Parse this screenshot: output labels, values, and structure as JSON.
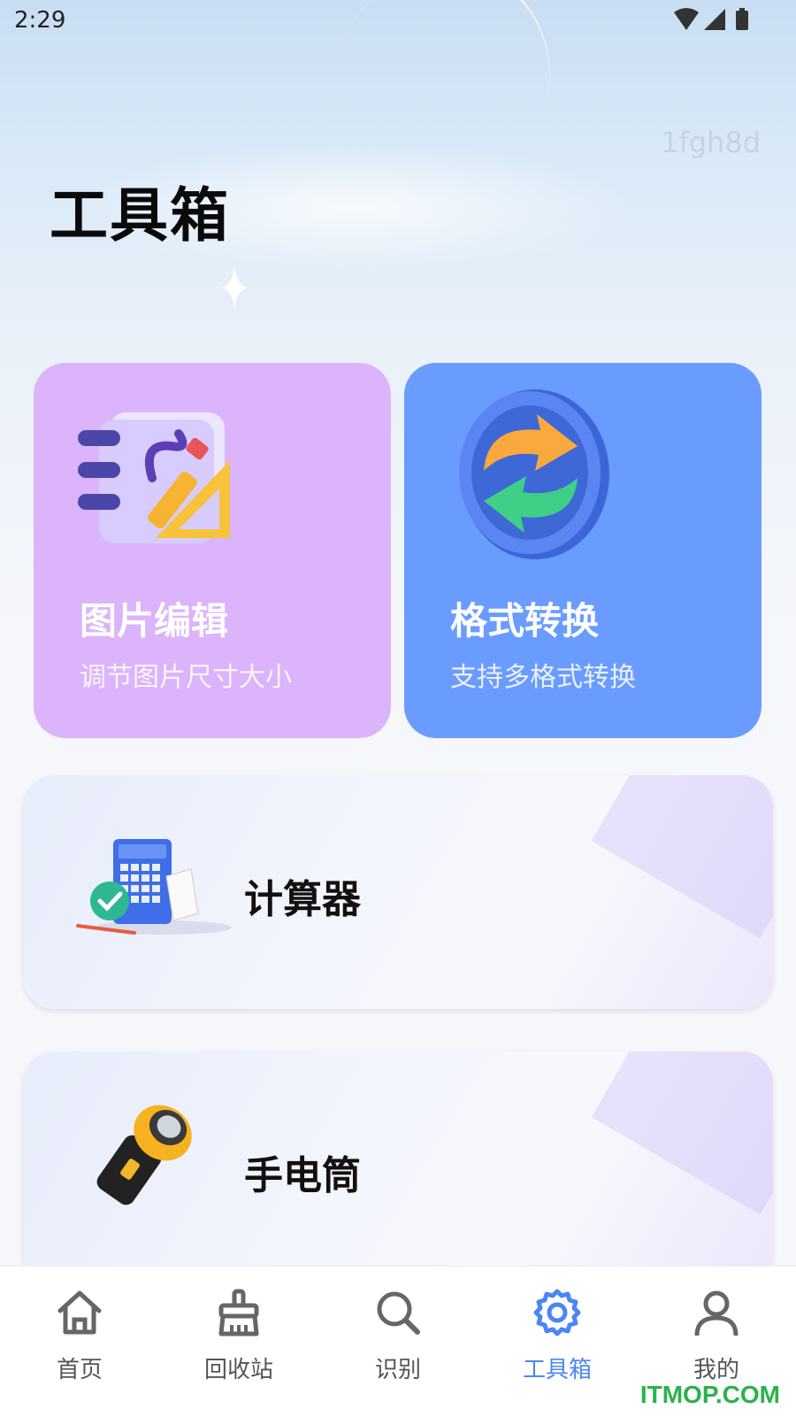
{
  "status_bar": {
    "time": "2:29"
  },
  "watermark_text": "1fgh8d",
  "page_title": "工具箱",
  "feature_cards": [
    {
      "title": "图片编辑",
      "subtitle": "调节图片尺寸大小",
      "icon": "image-edit-icon",
      "color": "#dbb4fc"
    },
    {
      "title": "格式转换",
      "subtitle": "支持多格式转换",
      "icon": "format-convert-icon",
      "color": "#6a9cff"
    }
  ],
  "tools": [
    {
      "title": "计算器",
      "icon": "calculator-icon"
    },
    {
      "title": "手电筒",
      "icon": "flashlight-icon"
    }
  ],
  "tab_bar": {
    "tabs": [
      {
        "label": "首页",
        "icon": "home-icon"
      },
      {
        "label": "回收站",
        "icon": "broom-icon"
      },
      {
        "label": "识别",
        "icon": "search-icon"
      },
      {
        "label": "工具箱",
        "icon": "gear-icon",
        "active": true
      },
      {
        "label": "我的",
        "icon": "user-icon"
      }
    ],
    "active_color": "#4b86f3"
  },
  "corner_brand": "ITMOP.COM"
}
